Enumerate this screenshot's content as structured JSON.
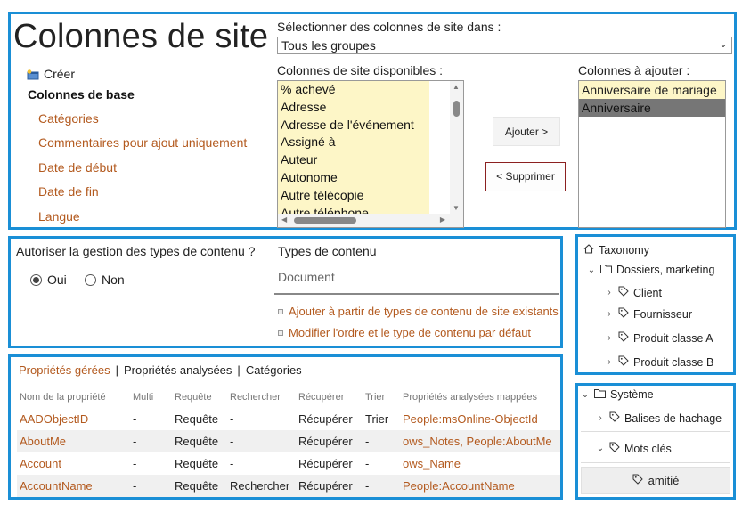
{
  "site_columns": {
    "title": "Colonnes de site",
    "create_label": "Créer",
    "group_name": "Colonnes de base",
    "nav_links": [
      "Catégories",
      "Commentaires pour ajout uniquement",
      "Date de début",
      "Date de fin",
      "Langue"
    ],
    "select_label": "Sélectionner des colonnes de site dans :",
    "select_value": "Tous les groupes",
    "available_label": "Colonnes de site disponibles :",
    "available_items": [
      "% achevé",
      "Adresse",
      "Adresse de l'événement",
      "Assigné à",
      "Auteur",
      "Autonome",
      "Autre télécopie",
      "Autre téléphone"
    ],
    "add_button": "Ajouter >",
    "remove_button": "< Supprimer",
    "to_add_label": "Colonnes à ajouter :",
    "to_add_items": [
      "Anniversaire de mariage",
      "Anniversaire"
    ]
  },
  "content_types": {
    "question": "Autoriser la gestion des types de contenu ?",
    "option_yes": "Oui",
    "option_no": "Non",
    "selected": "Oui",
    "label": "Types de contenu",
    "current": "Document",
    "links": [
      "Ajouter à partir de types de contenu de site existants",
      "Modifier l'ordre et le type de contenu par défaut"
    ]
  },
  "properties": {
    "tabs": [
      "Propriétés gérées",
      "Propriétés analysées",
      "Catégories"
    ],
    "active_tab": "Propriétés gérées",
    "columns": [
      "Nom de la propriété",
      "Multi",
      "Requête",
      "Rechercher",
      "Récupérer",
      "Trier",
      "Propriétés analysées mappées"
    ],
    "rows": [
      {
        "name": "AADObjectID",
        "multi": "-",
        "query": "Requête",
        "search": "-",
        "retrieve": "Récupérer",
        "sort": "Trier",
        "mapped": "People:msOnline-ObjectId"
      },
      {
        "name": "AboutMe",
        "multi": "-",
        "query": "Requête",
        "search": "-",
        "retrieve": "Récupérer",
        "sort": "-",
        "mapped": "ows_Notes, People:AboutMe"
      },
      {
        "name": "Account",
        "multi": "-",
        "query": "Requête",
        "search": "-",
        "retrieve": "Récupérer",
        "sort": "-",
        "mapped": "ows_Name"
      },
      {
        "name": "AccountName",
        "multi": "-",
        "query": "Requête",
        "search": "Rechercher",
        "retrieve": "Récupérer",
        "sort": "-",
        "mapped": "People:AccountName"
      }
    ]
  },
  "taxonomy": {
    "root": "Taxonomy",
    "group": "Dossiers, marketing",
    "terms": [
      "Client",
      "Fournisseur",
      "Produit classe A",
      "Produit classe B"
    ]
  },
  "system": {
    "root": "Système",
    "items": [
      "Balises de hachage",
      "Mots clés"
    ],
    "button": "amitié"
  },
  "colors": {
    "accent_border": "#1a8fd6",
    "link": "#b35a1f",
    "highlight": "#fdf6c7"
  }
}
